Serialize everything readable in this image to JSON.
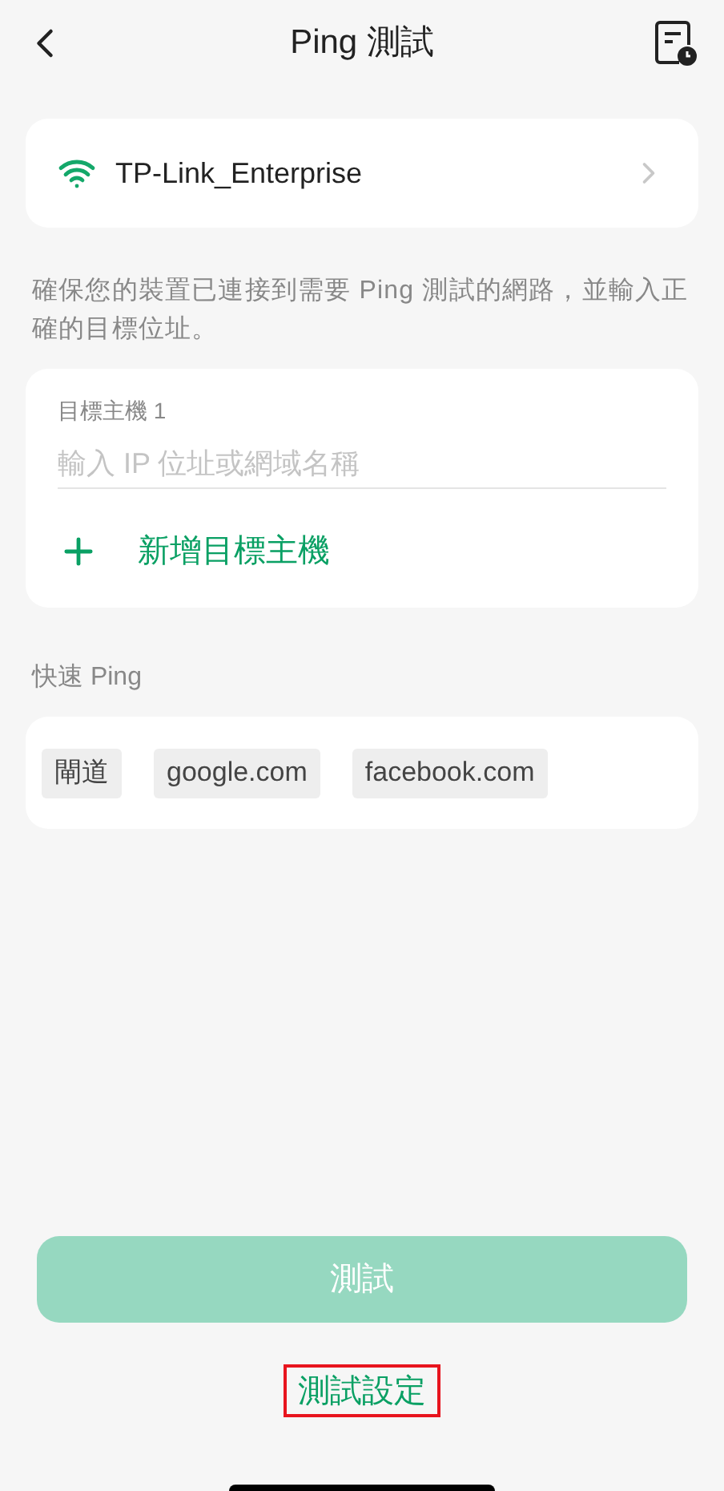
{
  "header": {
    "title": "Ping 測試"
  },
  "network": {
    "name": "TP-Link_Enterprise"
  },
  "description": "確保您的裝置已連接到需要 Ping 測試的網路，並輸入正確的目標位址。",
  "targets": [
    {
      "label": "目標主機 1",
      "placeholder": "輸入 IP 位址或網域名稱"
    }
  ],
  "add_target": "新增目標主機",
  "quick_ping": {
    "title": "快速 Ping",
    "items": [
      "閘道",
      "google.com",
      "facebook.com"
    ]
  },
  "test_button": {
    "label": "測試",
    "disabled": true
  },
  "settings_link": {
    "label": "測試設定",
    "highlighted": true
  }
}
